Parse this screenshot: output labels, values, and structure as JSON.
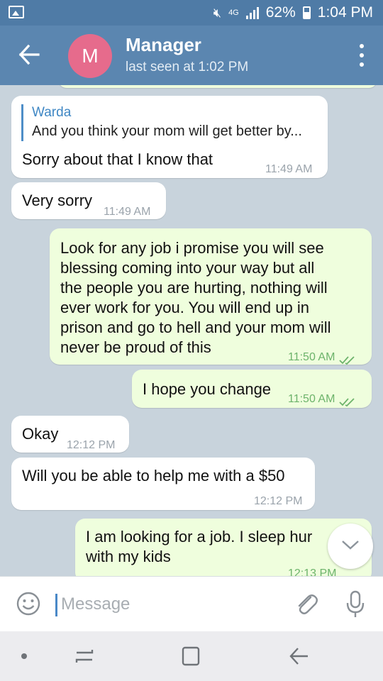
{
  "status_bar": {
    "battery": "62%",
    "time": "1:04 PM",
    "network": "4G"
  },
  "header": {
    "avatar_letter": "M",
    "avatar_color": "#e66b8c",
    "title": "Manager",
    "subtitle": "last seen at 1:02 PM",
    "accent": "#5b86b0"
  },
  "messages": [
    {
      "reply_name": "Warda",
      "reply_text": "And you think your mom will get better by...",
      "text": "Sorry about that I know that",
      "time": "11:49 AM"
    },
    {
      "text": "Very sorry",
      "time": "11:49 AM"
    },
    {
      "lines": [
        "Look for any job i promise you will see",
        "blessing coming into your way but all",
        "the people you are hurting, nothing will",
        "ever work for you. You will end up in",
        "prison and go to hell and your mom will",
        "never be proud of this"
      ],
      "time": "11:50 AM"
    },
    {
      "text": "I hope you change",
      "time": "11:50 AM"
    },
    {
      "text": "Okay",
      "time": "12:12 PM"
    },
    {
      "text": "Will you be able to help me with a $50",
      "time": "12:12 PM"
    },
    {
      "lines": [
        "I am looking for a job. I sleep hur",
        "with my kids"
      ],
      "time": "12:13 PM"
    }
  ],
  "input": {
    "placeholder": "Message"
  },
  "icons": {
    "back": "arrow-left-icon",
    "menu": "more-vert-icon",
    "emoji": "emoji-icon",
    "attach": "paperclip-icon",
    "mic": "microphone-icon",
    "scroll": "chevron-down-icon"
  }
}
